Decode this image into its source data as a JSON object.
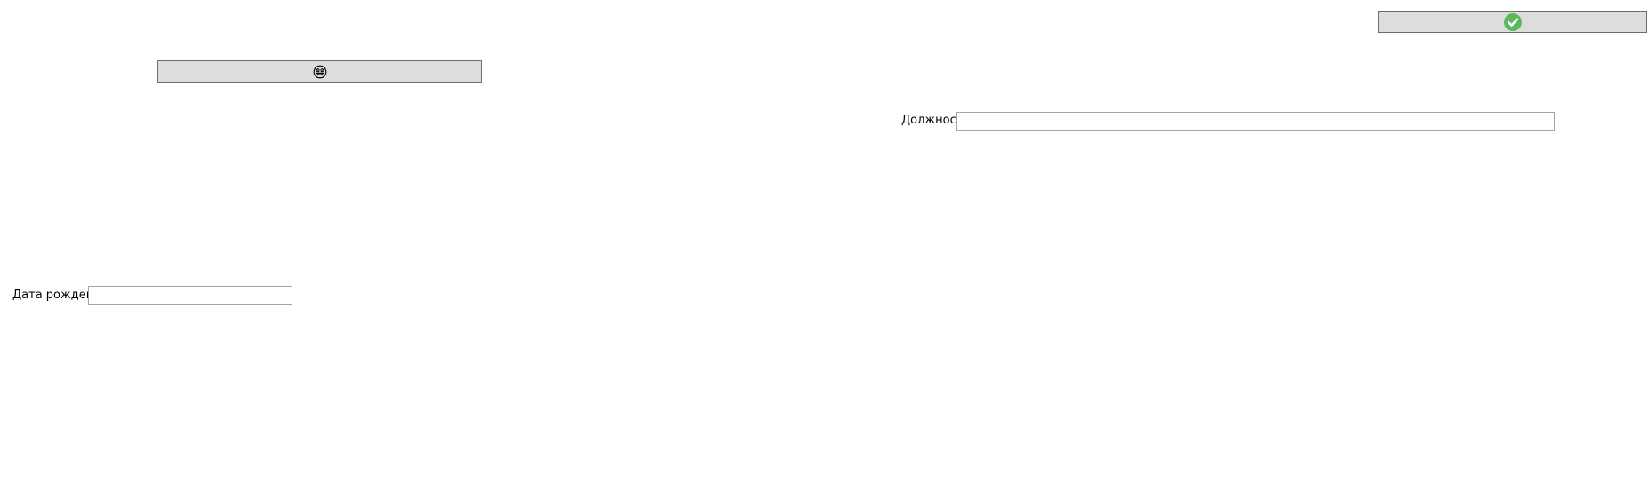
{
  "buttons": {
    "emoji_icon": "grinning-face-icon",
    "confirm_icon": "check-circle-icon",
    "confirm_color": "#5cb85c"
  },
  "form": {
    "position_label": "Должность",
    "position_value": "",
    "birth_date_label": "Дата рождения",
    "birth_date_value": ""
  }
}
